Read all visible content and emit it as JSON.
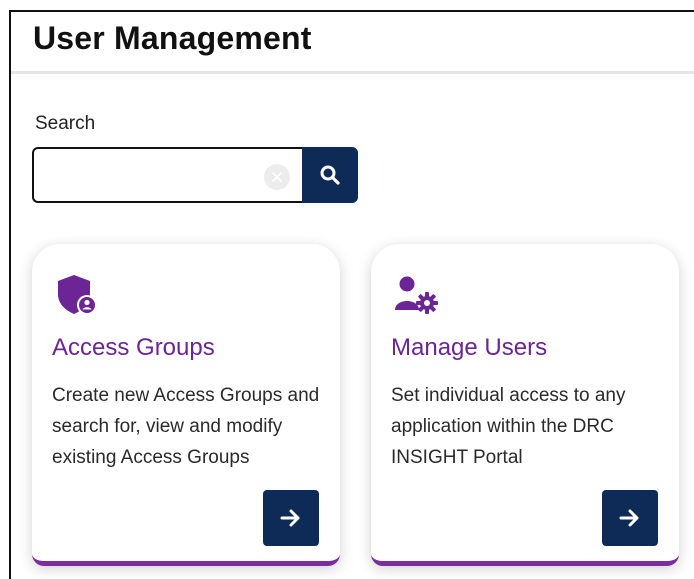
{
  "page": {
    "title": "User Management"
  },
  "search": {
    "label": "Search",
    "value": "",
    "placeholder": ""
  },
  "cards": [
    {
      "icon": "shield-user-icon",
      "title": "Access Groups",
      "description": "Create new Access Groups and search for, view and modify existing Access Groups"
    },
    {
      "icon": "user-gear-icon",
      "title": "Manage Users",
      "description": "Set individual access to any application within the DRC INSIGHT Portal"
    }
  ],
  "colors": {
    "navy": "#0e2a56",
    "purple": "#6b2595",
    "accent_bar": "#7b2d9e"
  }
}
